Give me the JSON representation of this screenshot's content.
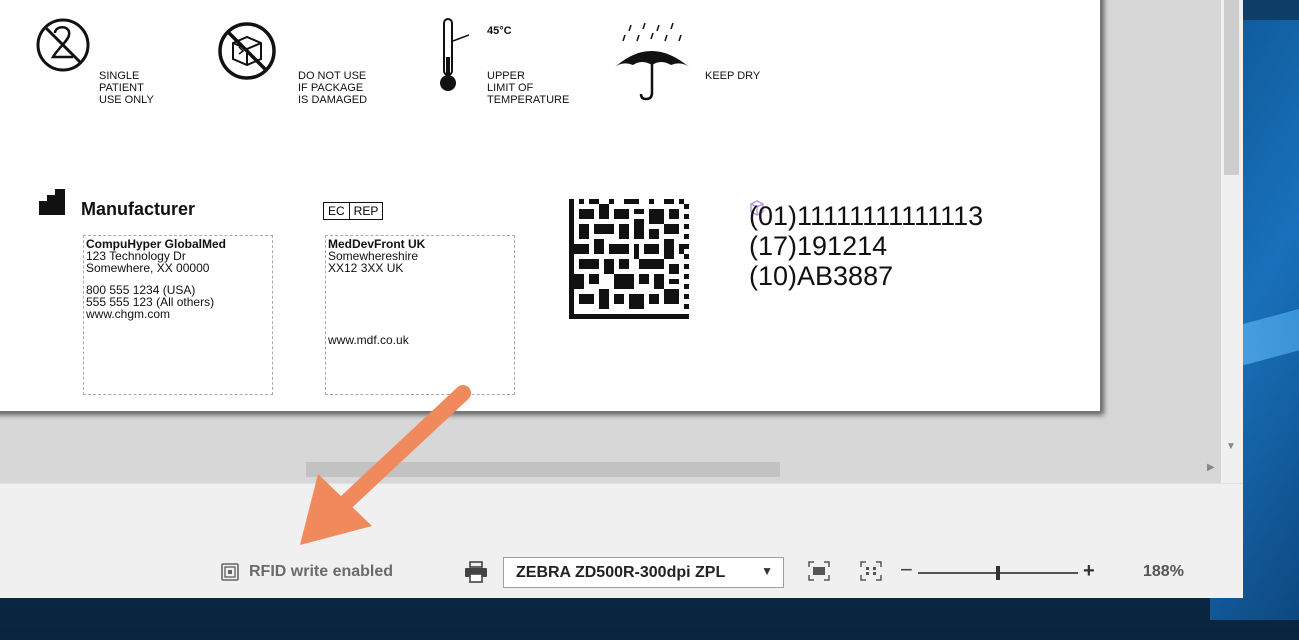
{
  "label": {
    "symbols": [
      {
        "icon": "single-patient-use-icon",
        "lines": [
          "SINGLE",
          "PATIENT",
          "USE ONLY"
        ]
      },
      {
        "icon": "do-not-use-damaged-icon",
        "lines": [
          "DO NOT USE",
          "IF PACKAGE",
          "IS DAMAGED"
        ]
      },
      {
        "icon": "temperature-limit-icon",
        "limit": "45°C",
        "lines": [
          "UPPER",
          "LIMIT OF",
          "TEMPERATURE"
        ]
      },
      {
        "icon": "keep-dry-icon",
        "lines": [
          "KEEP DRY"
        ]
      }
    ],
    "manufacturer": {
      "title": "Manufacturer",
      "name": "CompuHyper GlobalMed",
      "street": "123 Technology Dr",
      "city": "Somewhere, XX 00000",
      "phone_usa": "800 555 1234 (USA)",
      "phone_other": "555 555 123 (All others)",
      "web": "www.chgm.com"
    },
    "ec_rep": {
      "badge_left": "EC",
      "badge_right": "REP",
      "name": "MedDevFront UK",
      "region": "Somewhereshire",
      "postcode": "XX12 3XX UK",
      "web": "www.mdf.co.uk"
    },
    "udi": {
      "gtin": "(01)11111111111113",
      "date": "(17)191214",
      "lot": "(10)AB3887"
    }
  },
  "statusbar": {
    "rfid_label": "RFID write enabled",
    "printer": "ZEBRA ZD500R-300dpi ZPL",
    "zoom_minus": "−",
    "zoom_plus": "+",
    "zoom_level": "188%",
    "zoom_fraction": 0.5
  },
  "colors": {
    "annotation_arrow": "#f08a5d",
    "desktop": "#0b3b67"
  }
}
